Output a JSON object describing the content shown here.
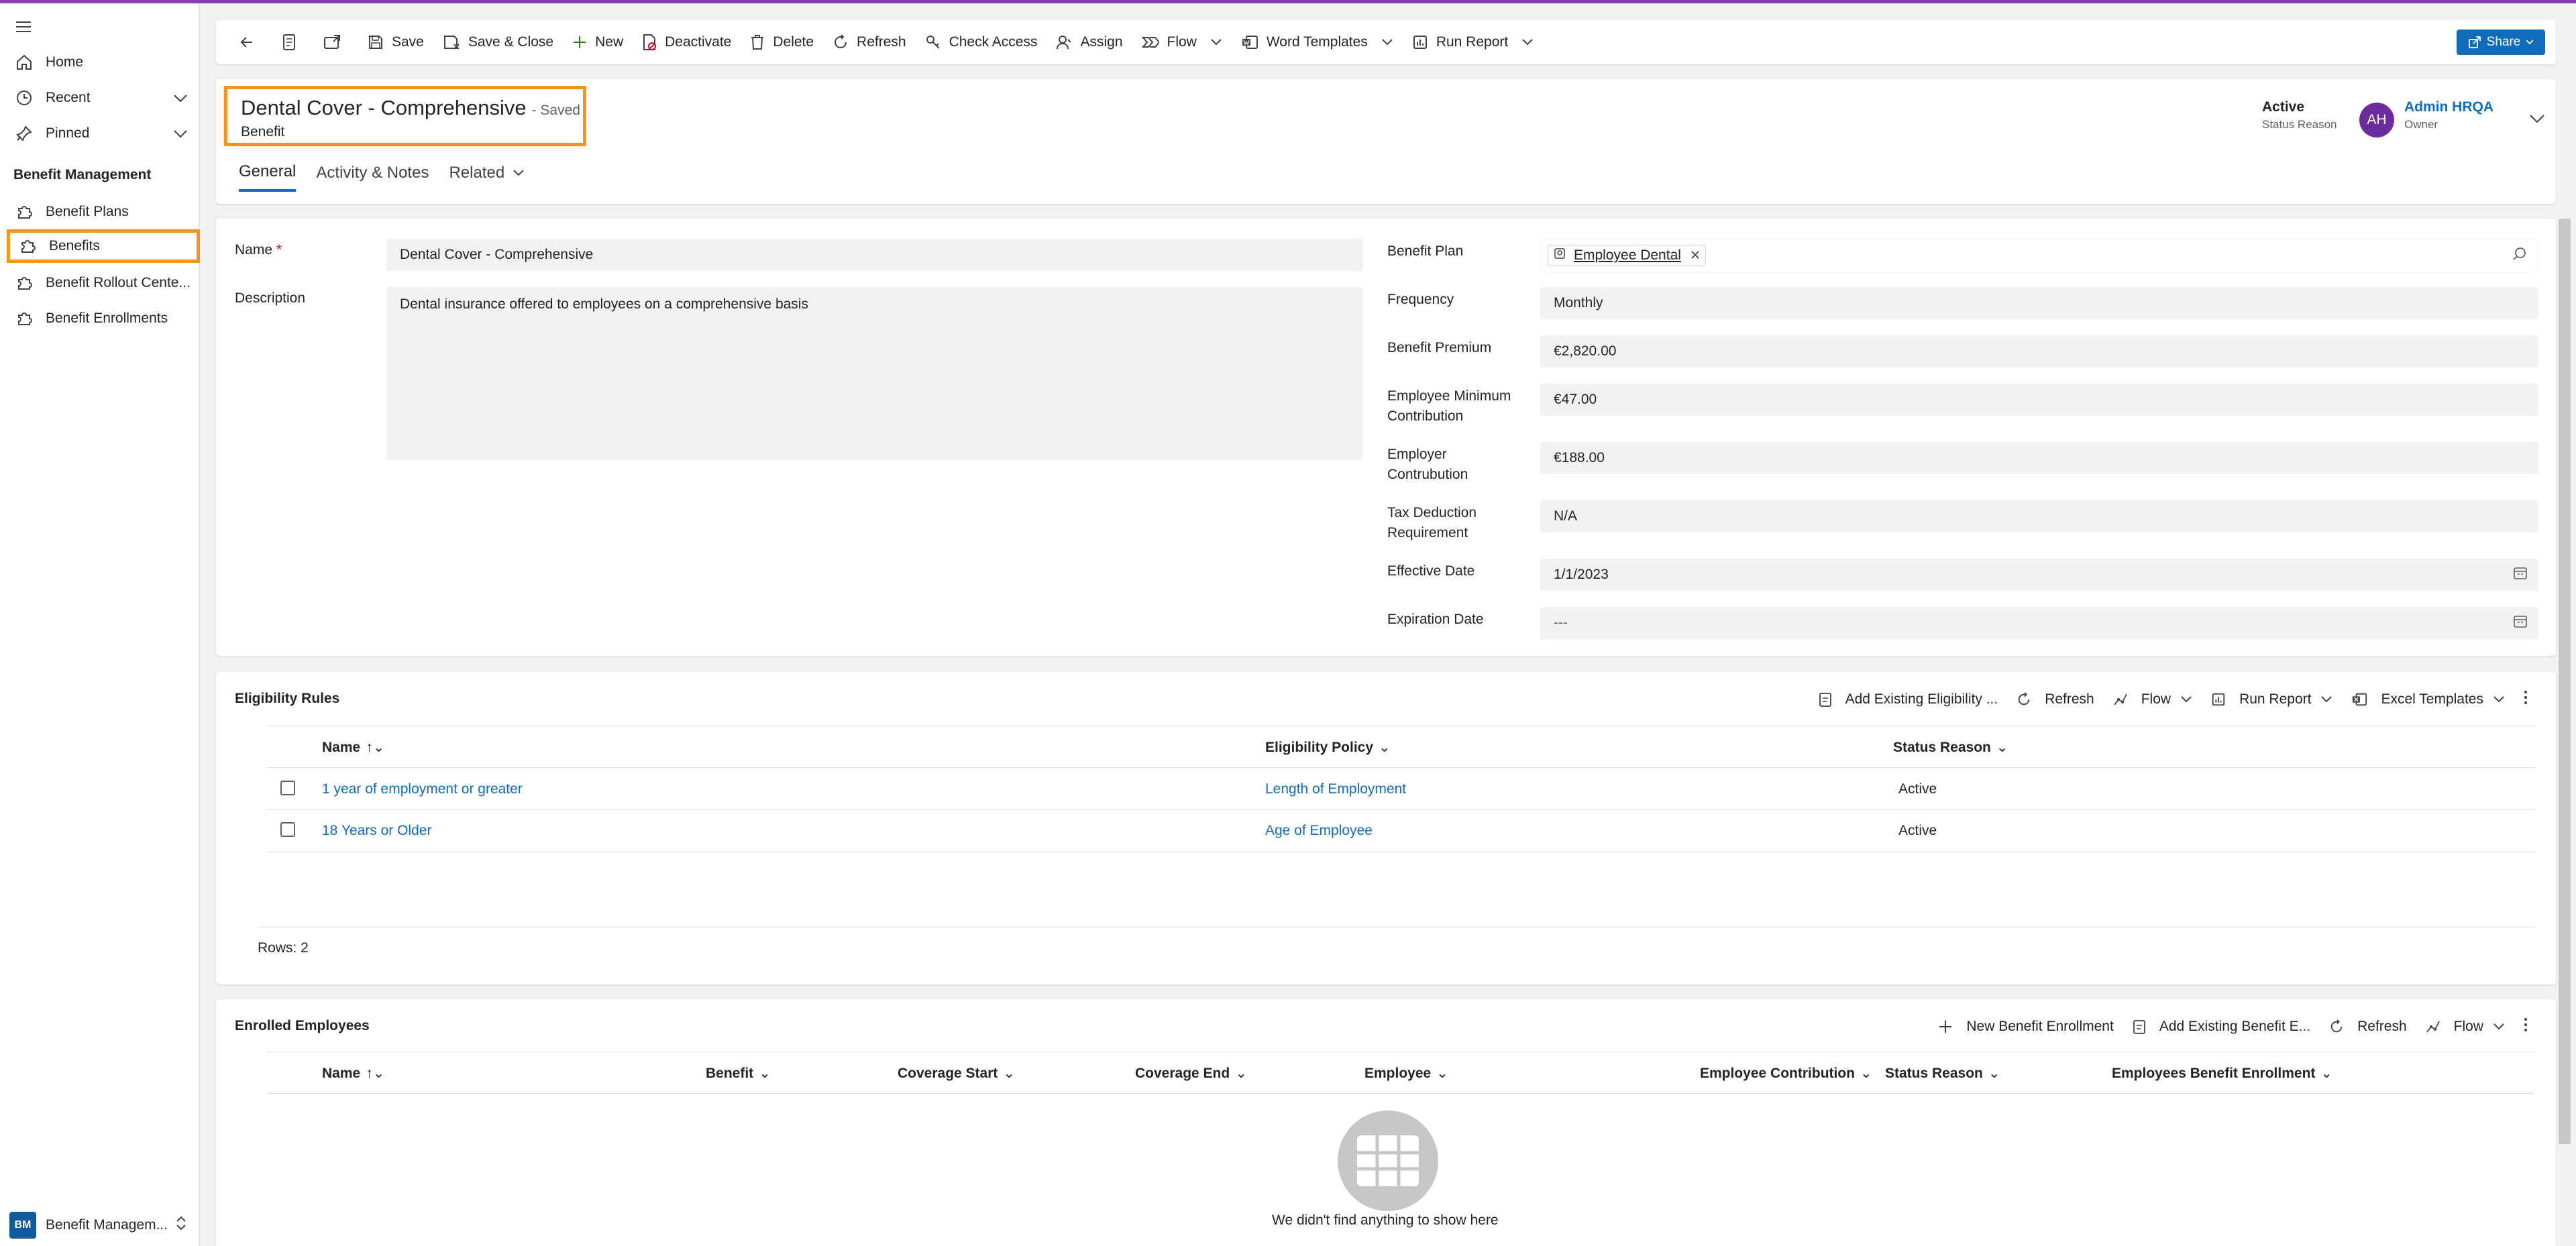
{
  "nav": {
    "home": "Home",
    "recent": "Recent",
    "pinned": "Pinned",
    "section_title": "Benefit Management",
    "items": [
      {
        "label": "Benefit Plans"
      },
      {
        "label": "Benefits"
      },
      {
        "label": "Benefit Rollout Cente..."
      },
      {
        "label": "Benefit Enrollments"
      }
    ],
    "app_badge": "BM",
    "app_name": "Benefit Managem..."
  },
  "toolbar": {
    "save": "Save",
    "save_close": "Save & Close",
    "new": "New",
    "deactivate": "Deactivate",
    "delete": "Delete",
    "refresh": "Refresh",
    "check_access": "Check Access",
    "assign": "Assign",
    "flow": "Flow",
    "word_templates": "Word Templates",
    "run_report": "Run Report",
    "share": "Share"
  },
  "record": {
    "title": "Dental Cover - Comprehensive",
    "saved_status": "- Saved",
    "entity": "Benefit",
    "status_value": "Active",
    "status_label": "Status Reason",
    "owner_initials": "AH",
    "owner_name": "Admin HRQA",
    "owner_label": "Owner"
  },
  "tabs": {
    "general": "General",
    "activity": "Activity & Notes",
    "related": "Related"
  },
  "form": {
    "name_label": "Name",
    "required_mark": "*",
    "name_value": "Dental Cover - Comprehensive",
    "description_label": "Description",
    "description_value": "Dental insurance offered to employees on a comprehensive basis",
    "benefit_plan_label": "Benefit Plan",
    "benefit_plan_value": "Employee Dental",
    "frequency_label": "Frequency",
    "frequency_value": "Monthly",
    "premium_label": "Benefit Premium",
    "premium_value": "€2,820.00",
    "emp_min_label_1": "Employee Minimum",
    "emp_min_label_2": "Contribution",
    "emp_min_value": "€47.00",
    "employer_label_1": "Employer",
    "employer_label_2": "Contrubution",
    "employer_value": "€188.00",
    "tax_label_1": "Tax Deduction",
    "tax_label_2": "Requirement",
    "tax_value": "N/A",
    "effective_label": "Effective Date",
    "effective_value": "1/1/2023",
    "expiration_label": "Expiration Date",
    "expiration_value": "---"
  },
  "eligibility": {
    "title": "Eligibility Rules",
    "cmd_add_existing": "Add Existing Eligibility ...",
    "cmd_refresh": "Refresh",
    "cmd_flow": "Flow",
    "cmd_run_report": "Run Report",
    "cmd_excel": "Excel Templates",
    "col_name": "Name",
    "col_policy": "Eligibility Policy",
    "col_status": "Status Reason",
    "rows": [
      {
        "name": "1 year of employment or greater",
        "policy": "Length of Employment",
        "status": "Active"
      },
      {
        "name": "18 Years or Older",
        "policy": "Age of Employee",
        "status": "Active"
      }
    ],
    "rows_count": "Rows: 2"
  },
  "enrolled": {
    "title": "Enrolled Employees",
    "cmd_new": "New Benefit Enrollment",
    "cmd_add_existing": "Add Existing Benefit E...",
    "cmd_refresh": "Refresh",
    "cmd_flow": "Flow",
    "columns": [
      "Name",
      "Benefit",
      "Coverage Start",
      "Coverage End",
      "Employee",
      "Employee Contribution",
      "Status Reason",
      "Employees Benefit Enrollment"
    ],
    "empty_message": "We didn't find anything to show here"
  },
  "colors": {
    "accent": "#0f6cbd",
    "highlight": "#f7941d",
    "avatar": "#6b2d9e"
  }
}
